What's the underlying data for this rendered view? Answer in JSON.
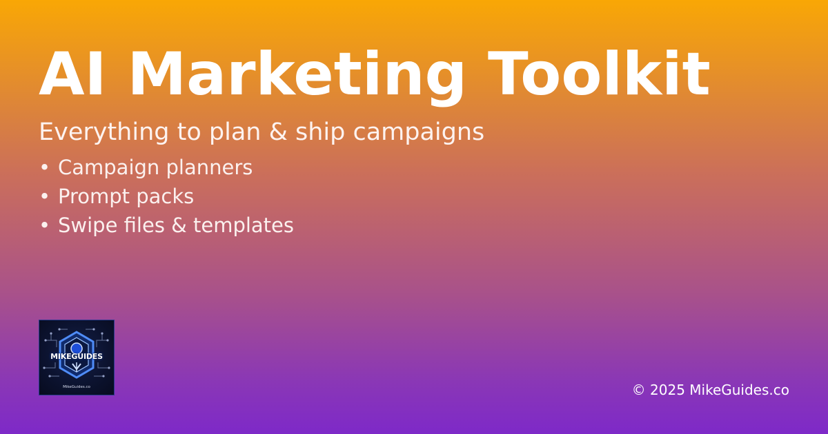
{
  "title": "AI Marketing Toolkit",
  "subtitle": "Everything to plan & ship campaigns",
  "features": [
    "Campaign planners",
    "Prompt packs",
    "Swipe files & templates"
  ],
  "bullet": "•",
  "logo": {
    "wordmark": "MIKEGUIDES",
    "url": "MikeGuides.co",
    "icon": "hexagon-circuit-logo"
  },
  "footer": {
    "copyright": "© 2025 MikeGuides.co"
  },
  "colors": {
    "gradient_top": "#F9A705",
    "gradient_middle": "#A8518B",
    "gradient_bottom": "#7E29C8",
    "text": "#FFFFFF",
    "logo_background": "#0C1330",
    "logo_accent": "#3B82F6"
  }
}
